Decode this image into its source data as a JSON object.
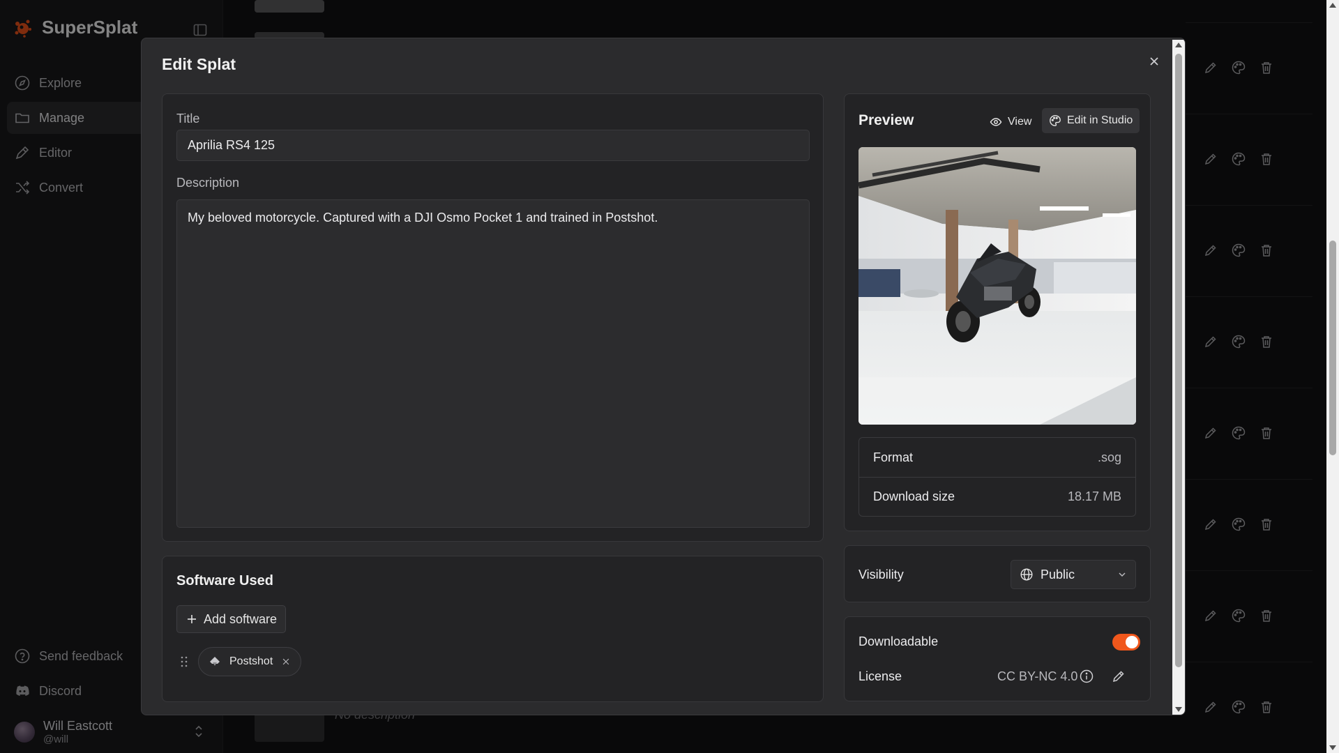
{
  "sidebar": {
    "brand": "SuperSplat",
    "nav": [
      {
        "label": "Explore",
        "icon": "compass-icon"
      },
      {
        "label": "Manage",
        "icon": "folder-icon",
        "active": true
      },
      {
        "label": "Editor",
        "icon": "brush-icon"
      },
      {
        "label": "Convert",
        "icon": "shuffle-icon"
      }
    ],
    "bottom": [
      {
        "label": "Send feedback",
        "icon": "help-circle-icon"
      },
      {
        "label": "Discord",
        "icon": "discord-icon"
      }
    ],
    "user": {
      "name": "Will Eastcott",
      "handle": "@will"
    }
  },
  "background": {
    "no_description": "No description"
  },
  "modal": {
    "title": "Edit Splat",
    "title_field": {
      "label": "Title",
      "value": "Aprilia RS4 125"
    },
    "description_field": {
      "label": "Description",
      "value": "My beloved motorcycle. Captured with a DJI Osmo Pocket 1 and trained in Postshot."
    },
    "software": {
      "heading": "Software Used",
      "add_label": "Add software",
      "items": [
        {
          "name": "Postshot"
        }
      ]
    },
    "preview": {
      "heading": "Preview",
      "view_label": "View",
      "studio_label": "Edit in Studio",
      "format_label": "Format",
      "format_value": ".sog",
      "size_label": "Download size",
      "size_value": "18.17 MB"
    },
    "visibility": {
      "label": "Visibility",
      "value": "Public"
    },
    "downloadable": {
      "label": "Downloadable",
      "enabled": true
    },
    "license": {
      "label": "License",
      "value": "CC BY-NC 4.0"
    }
  },
  "colors": {
    "accent": "#f0571c",
    "background": "#111113",
    "panel": "#232325"
  }
}
